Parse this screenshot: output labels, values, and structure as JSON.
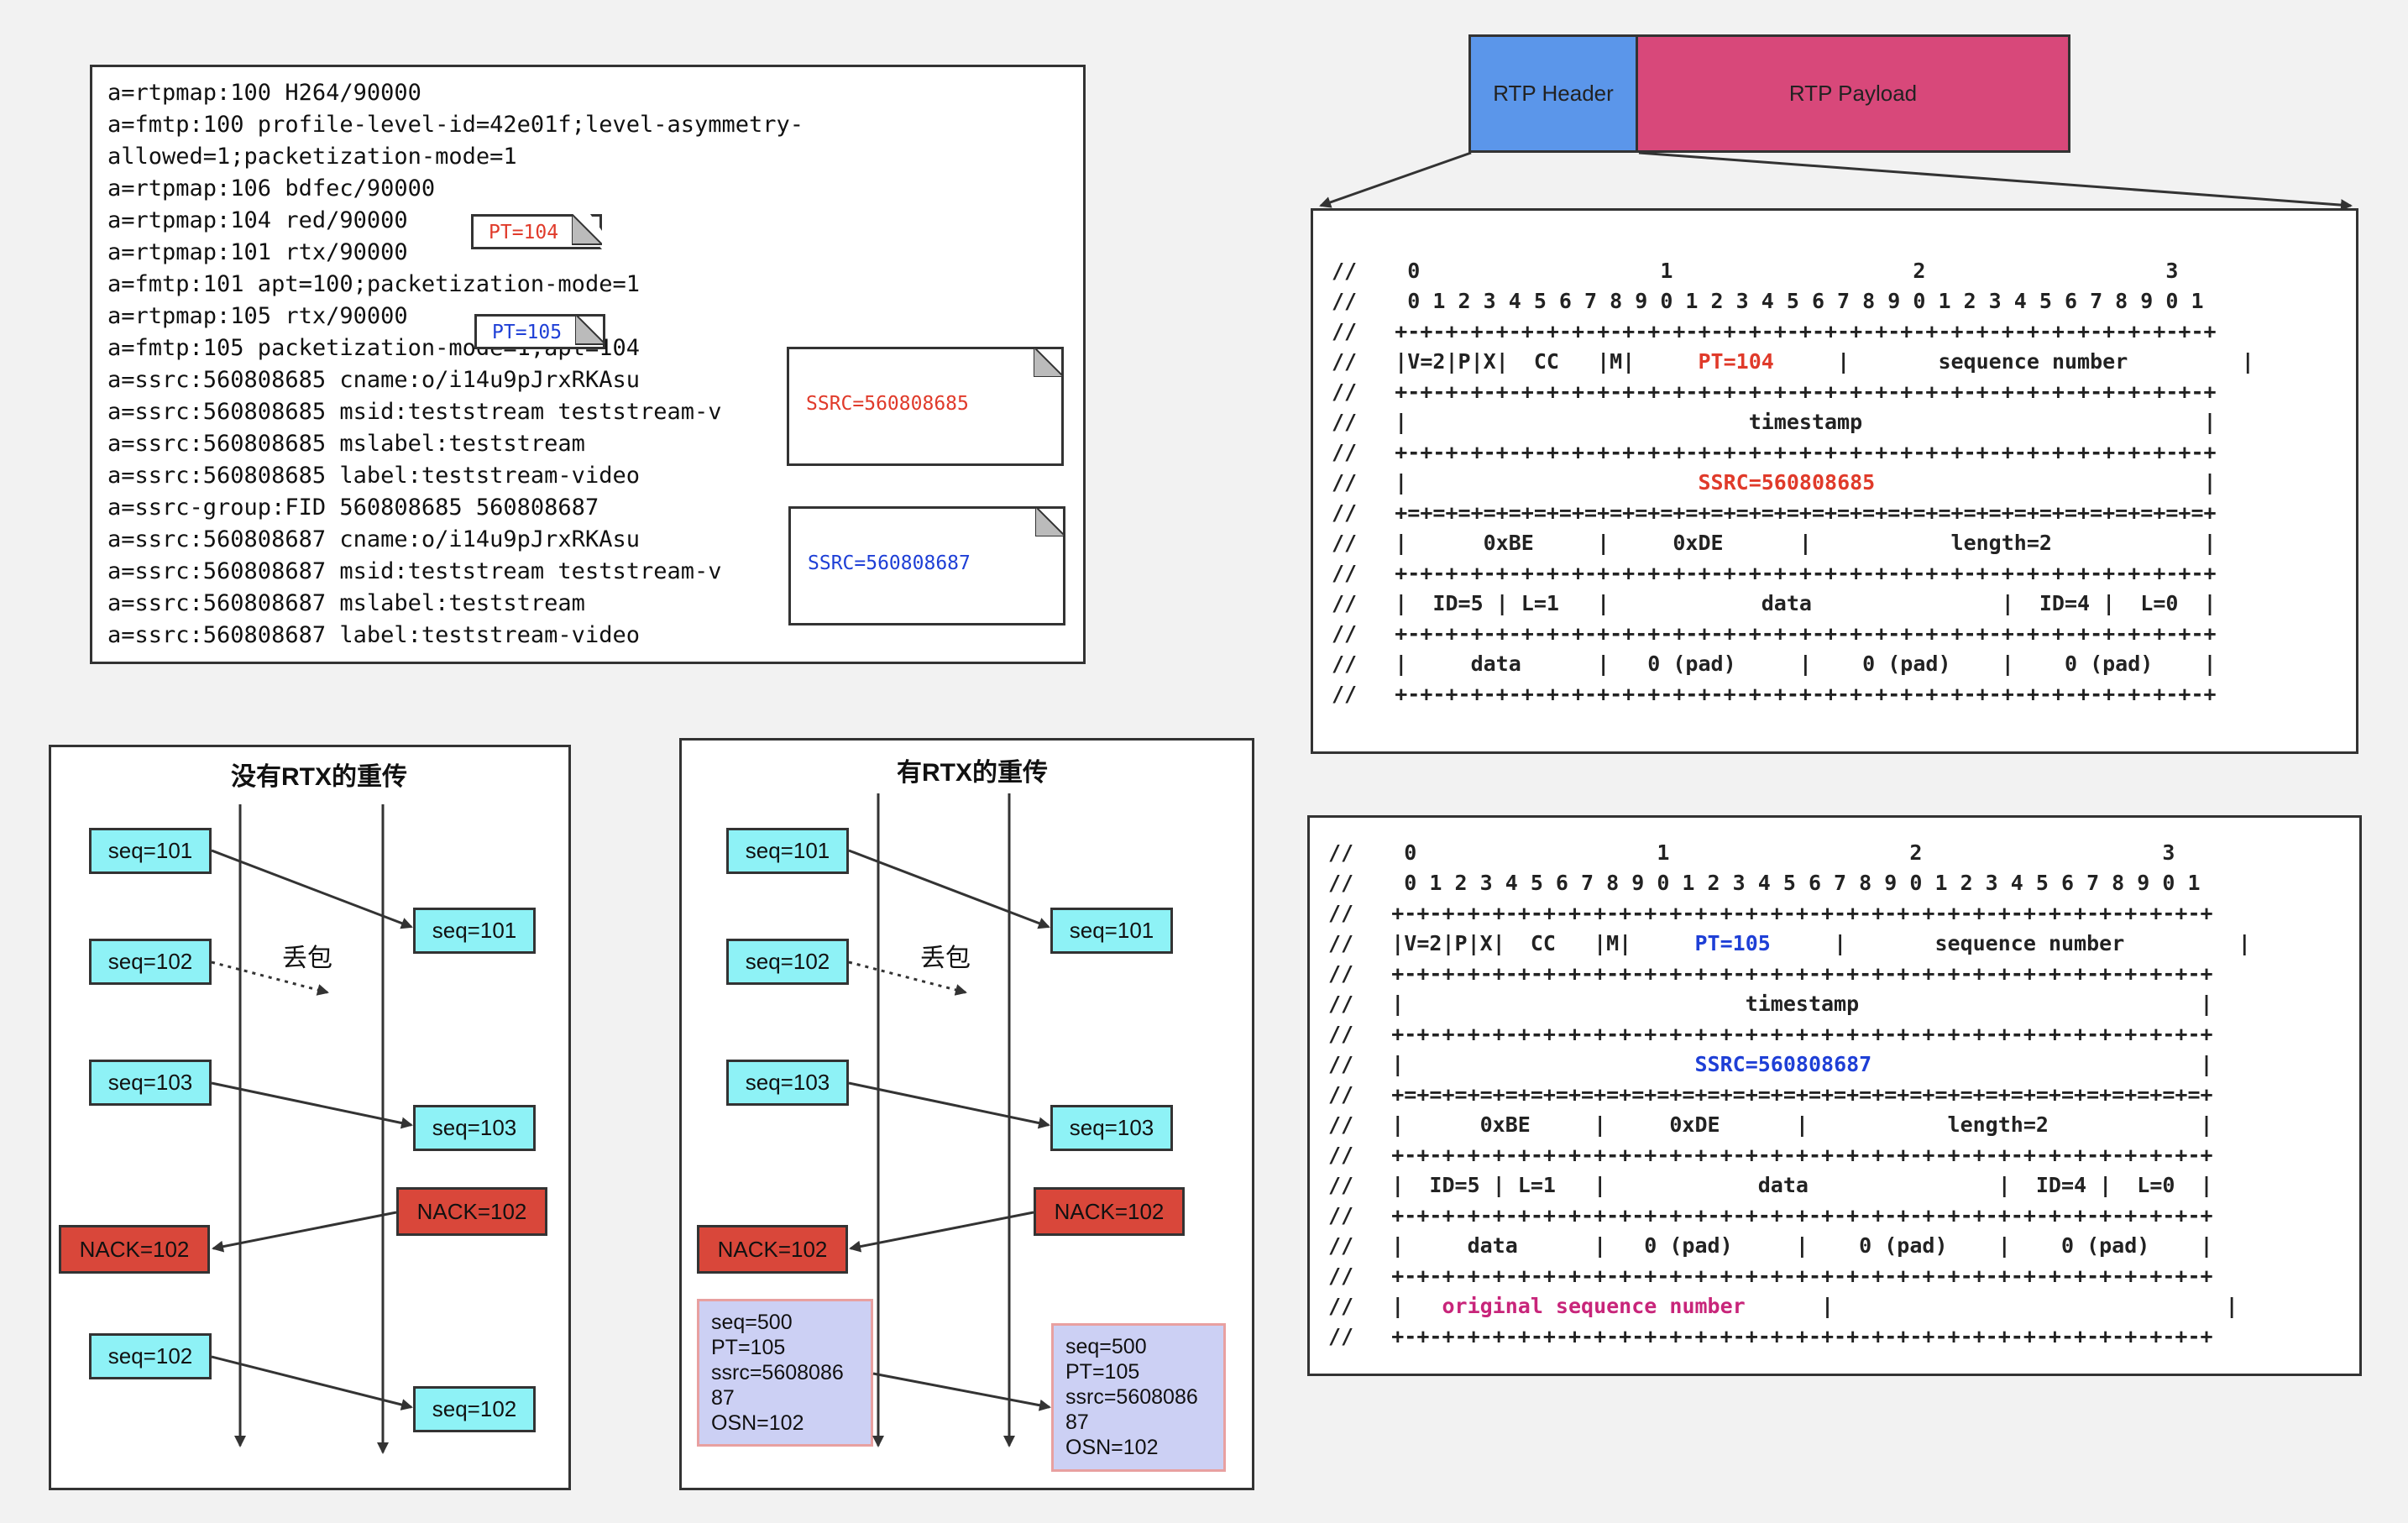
{
  "sdp": {
    "lines": [
      "a=rtpmap:100 H264/90000",
      "a=fmtp:100 profile-level-id=42e01f;level-asymmetry-",
      "allowed=1;packetization-mode=1",
      "a=rtpmap:106 bdfec/90000",
      "a=rtpmap:104 red/90000",
      "a=rtpmap:101 rtx/90000",
      "a=fmtp:101 apt=100;packetization-mode=1",
      "a=rtpmap:105 rtx/90000",
      "a=fmtp:105 packetization-mode=1;apt=104",
      "a=ssrc:560808685 cname:o/i14u9pJrxRKAsu",
      "a=ssrc:560808685 msid:teststream teststream-v",
      "a=ssrc:560808685 mslabel:teststream",
      "a=ssrc:560808685 label:teststream-video",
      "a=ssrc-group:FID 560808685 560808687",
      "a=ssrc:560808687 cname:o/i14u9pJrxRKAsu",
      "a=ssrc:560808687 msid:teststream teststream-v",
      "a=ssrc:560808687 mslabel:teststream",
      "a=ssrc:560808687 label:teststream-video"
    ],
    "note_pt104": "PT=104",
    "note_pt105": "PT=105",
    "note_ssrc1": "SSRC=560808685",
    "note_ssrc2": "SSRC=560808687"
  },
  "rtp_bar": {
    "header": "RTP Header",
    "payload": "RTP Payload"
  },
  "packet1": {
    "l01": "//    0                   1                   2                   3",
    "l02": "//    0 1 2 3 4 5 6 7 8 9 0 1 2 3 4 5 6 7 8 9 0 1 2 3 4 5 6 7 8 9 0 1",
    "l03": "//   +-+-+-+-+-+-+-+-+-+-+-+-+-+-+-+-+-+-+-+-+-+-+-+-+-+-+-+-+-+-+-+-+",
    "l04a": "//   |V=2|P|X|  CC   |M|     ",
    "l04b": "PT=104",
    "l04c": "     |       sequence number         |",
    "l05": "//   +-+-+-+-+-+-+-+-+-+-+-+-+-+-+-+-+-+-+-+-+-+-+-+-+-+-+-+-+-+-+-+-+",
    "l06": "//   |                           timestamp                           |",
    "l07": "//   +-+-+-+-+-+-+-+-+-+-+-+-+-+-+-+-+-+-+-+-+-+-+-+-+-+-+-+-+-+-+-+-+",
    "l08a": "//   |                       ",
    "l08b": "SSRC=560808685",
    "l08c": "                          |",
    "l09": "//   +=+=+=+=+=+=+=+=+=+=+=+=+=+=+=+=+=+=+=+=+=+=+=+=+=+=+=+=+=+=+=+=+",
    "l10": "//   |      0xBE     |     0xDE      |           length=2            |",
    "l11": "//   +-+-+-+-+-+-+-+-+-+-+-+-+-+-+-+-+-+-+-+-+-+-+-+-+-+-+-+-+-+-+-+-+",
    "l12": "//   |  ID=5 | L=1   |            data               |  ID=4 |  L=0  |",
    "l13": "//   +-+-+-+-+-+-+-+-+-+-+-+-+-+-+-+-+-+-+-+-+-+-+-+-+-+-+-+-+-+-+-+-+",
    "l14": "//   |     data      |   0 (pad)     |    0 (pad)    |    0 (pad)    |",
    "l15": "//   +-+-+-+-+-+-+-+-+-+-+-+-+-+-+-+-+-+-+-+-+-+-+-+-+-+-+-+-+-+-+-+-+"
  },
  "packet2": {
    "l01": "//    0                   1                   2                   3",
    "l02": "//    0 1 2 3 4 5 6 7 8 9 0 1 2 3 4 5 6 7 8 9 0 1 2 3 4 5 6 7 8 9 0 1",
    "l03": "//   +-+-+-+-+-+-+-+-+-+-+-+-+-+-+-+-+-+-+-+-+-+-+-+-+-+-+-+-+-+-+-+-+",
    "l04a": "//   |V=2|P|X|  CC   |M|     ",
    "l04b": "PT=105",
    "l04c": "     |       sequence number         |",
    "l05": "//   +-+-+-+-+-+-+-+-+-+-+-+-+-+-+-+-+-+-+-+-+-+-+-+-+-+-+-+-+-+-+-+-+",
    "l06": "//   |                           timestamp                           |",
    "l07": "//   +-+-+-+-+-+-+-+-+-+-+-+-+-+-+-+-+-+-+-+-+-+-+-+-+-+-+-+-+-+-+-+-+",
    "l08a": "//   |                       ",
    "l08b": "SSRC=560808687",
    "l08c": "                          |",
    "l09": "//   +=+=+=+=+=+=+=+=+=+=+=+=+=+=+=+=+=+=+=+=+=+=+=+=+=+=+=+=+=+=+=+=+",
    "l10": "//   |      0xBE     |     0xDE      |           length=2            |",
    "l11": "//   +-+-+-+-+-+-+-+-+-+-+-+-+-+-+-+-+-+-+-+-+-+-+-+-+-+-+-+-+-+-+-+-+",
    "l12": "//   |  ID=5 | L=1   |            data               |  ID=4 |  L=0  |",
    "l13": "//   +-+-+-+-+-+-+-+-+-+-+-+-+-+-+-+-+-+-+-+-+-+-+-+-+-+-+-+-+-+-+-+-+",
    "l14": "//   |     data      |   0 (pad)     |    0 (pad)    |    0 (pad)    |",
    "l15": "//   +-+-+-+-+-+-+-+-+-+-+-+-+-+-+-+-+-+-+-+-+-+-+-+-+-+-+-+-+-+-+-+-+",
    "l16a": "//   |   ",
    "l16b": "original sequence number",
    "l16c": "      |                               |",
    "l17": "//   +-+-+-+-+-+-+-+-+-+-+-+-+-+-+-+-+-+-+-+-+-+-+-+-+-+-+-+-+-+-+-+-+"
  },
  "diagram_no_rtx": {
    "title": "没有RTX的重传",
    "loss_label": "丢包",
    "seq101_left": "seq=101",
    "seq101_right": "seq=101",
    "seq102_left": "seq=102",
    "seq103_left": "seq=103",
    "seq103_right": "seq=103",
    "nack_right": "NACK=102",
    "nack_left": "NACK=102",
    "seq102_retx_left": "seq=102",
    "seq102_retx_right": "seq=102"
  },
  "diagram_rtx": {
    "title": "有RTX的重传",
    "loss_label": "丢包",
    "seq101_left": "seq=101",
    "seq101_right": "seq=101",
    "seq102_left": "seq=102",
    "seq103_left": "seq=103",
    "seq103_right": "seq=103",
    "nack_right": "NACK=102",
    "nack_left": "NACK=102",
    "rtx_left": "seq=500\nPT=105\nssrc=5608086\n87\nOSN=102",
    "rtx_right": "seq=500\nPT=105\nssrc=5608086\n87\nOSN=102"
  },
  "colors": {
    "background": "#f2f2f2",
    "rtp_header": "#5b96ea",
    "rtp_payload": "#d8487a",
    "seq_box": "#8ef2f6",
    "nack_box": "#d9473a",
    "rtx_box": "#ccd0f4",
    "pt104_red": "#e03a2a",
    "pt105_blue": "#1e3fd6"
  }
}
